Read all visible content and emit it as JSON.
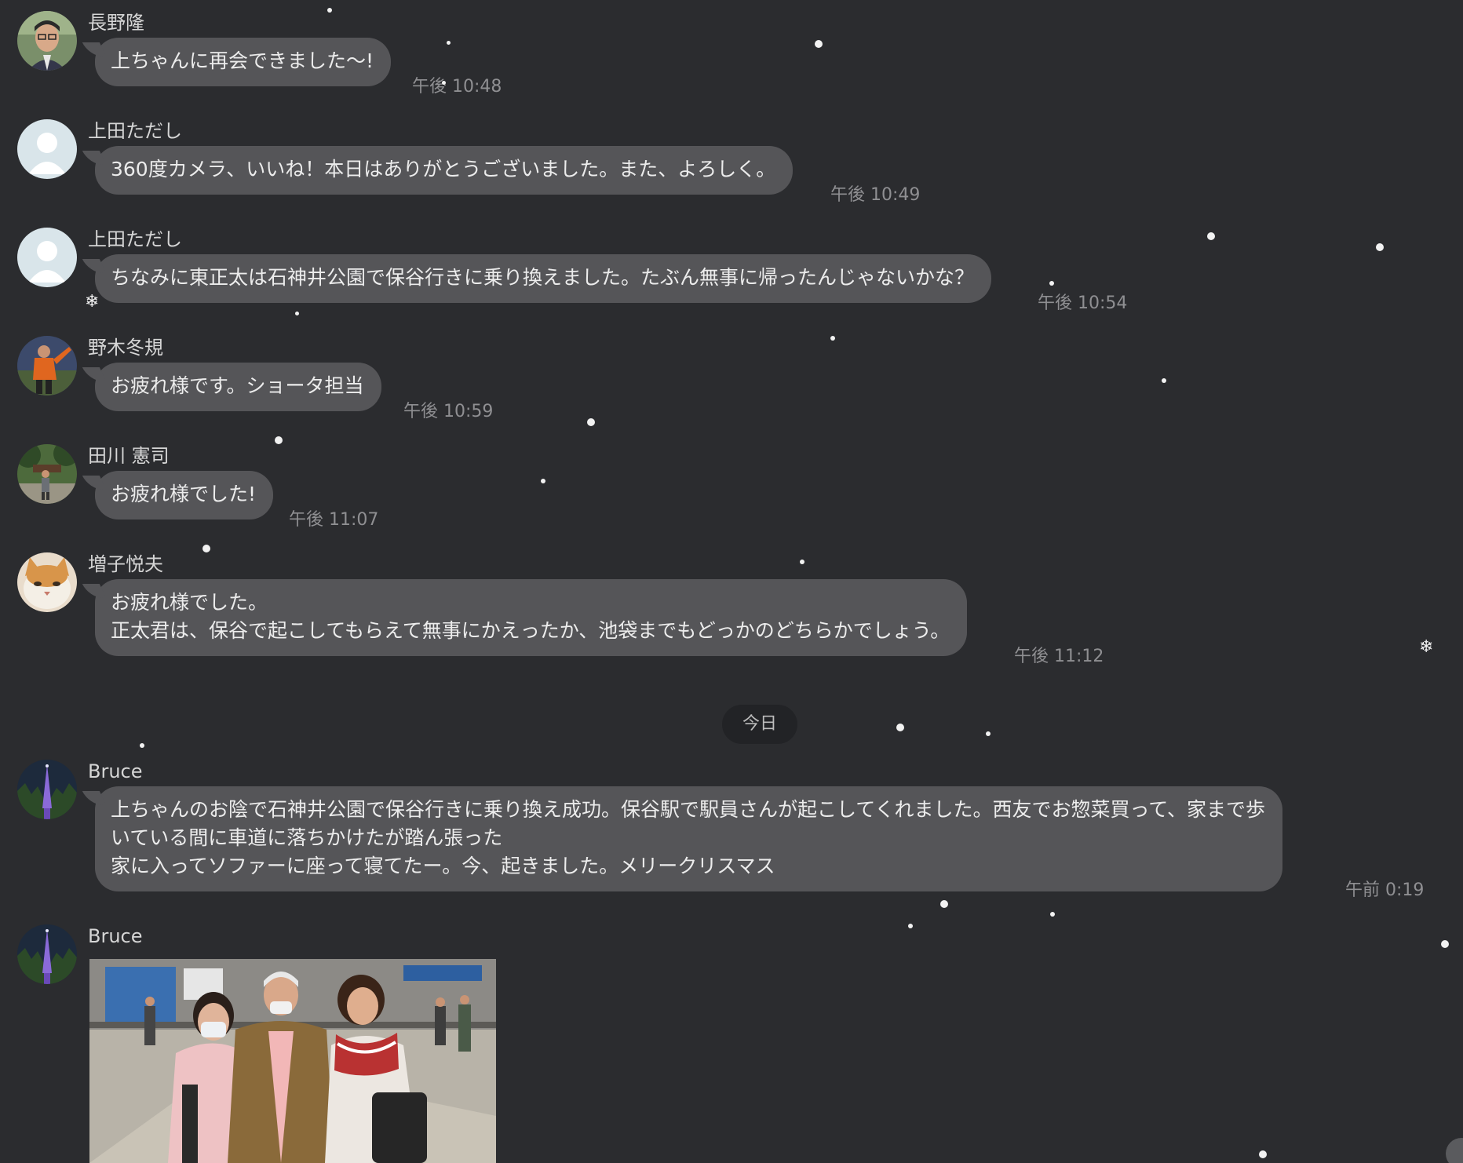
{
  "colors": {
    "background": "#2b2c2f",
    "bubble": "#555558",
    "bubble_text": "#ececec",
    "sender_text": "#d6d6d6",
    "timestamp_text": "#8f8f92",
    "date_pill": "#222326",
    "snow": "#f2f2f2"
  },
  "messages": [
    {
      "sender": "長野隆",
      "avatar": "avatar-photo-man",
      "lines": [
        "上ちゃんに再会できました〜!"
      ],
      "time": "午後 10:48"
    },
    {
      "sender": "上田ただし",
      "avatar": "default-avatar-icon",
      "lines": [
        "360度カメラ、いいね！本日はありがとうございました。また、よろしく。"
      ],
      "time": "午後 10:49"
    },
    {
      "sender": "上田ただし",
      "avatar": "default-avatar-icon",
      "lines": [
        "ちなみに東正太は石神井公園で保谷行きに乗り換えました。たぶん無事に帰ったんじゃないかな？"
      ],
      "time": "午後 10:54"
    },
    {
      "sender": "野木冬規",
      "avatar": "avatar-photo-soccer-player",
      "lines": [
        "お疲れ様です。ショータ担当"
      ],
      "time": "午後 10:59"
    },
    {
      "sender": "田川 憲司",
      "avatar": "avatar-photo-person-in-park",
      "lines": [
        "お疲れ様でした!"
      ],
      "time": "午後 11:07"
    },
    {
      "sender": "増子悦夫",
      "avatar": "avatar-photo-cat",
      "lines": [
        "お疲れ様でした。",
        "正太君は、保谷で起こしてもらえて無事にかえったか、池袋までもどっかのどちらかでしょう。"
      ],
      "time": "午後 11:12"
    },
    {
      "sender": "Bruce",
      "avatar": "avatar-photo-lit-tower",
      "lines": [
        "上ちゃんのお陰で石神井公園で保谷行きに乗り換え成功。保谷駅で駅員さんが起こしてくれました。西友でお惣菜買って、家まで歩",
        "いている間に車道に落ちかけたが踏ん張った",
        "家に入ってソファーに座って寝てたー。今、起きました。メリークリスマス"
      ],
      "time": "午前 0:19"
    },
    {
      "sender": "Bruce",
      "avatar": "avatar-photo-lit-tower",
      "image": "photo-three-people-station"
    }
  ],
  "date_divider": "今日"
}
